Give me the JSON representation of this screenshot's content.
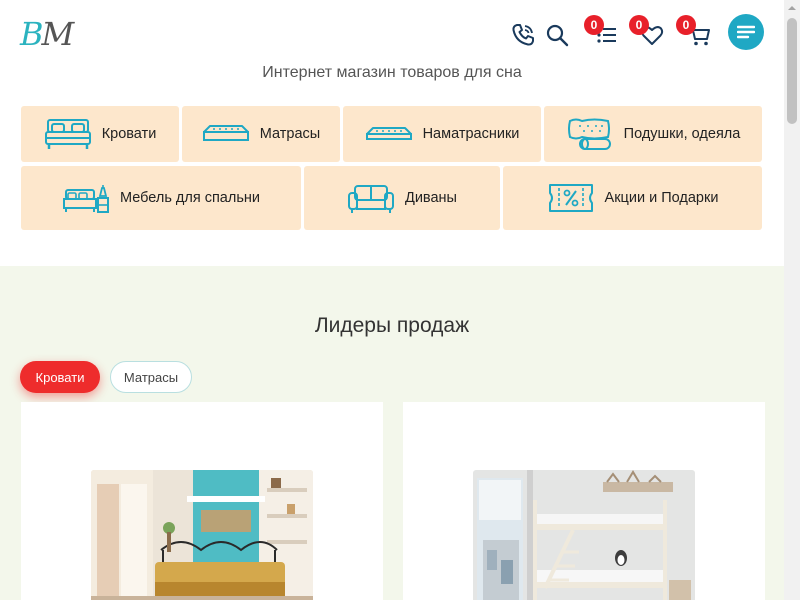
{
  "header": {
    "logo_letters": [
      "В",
      "М"
    ],
    "tagline": "Интернет магазин товаров для сна",
    "icons": {
      "phone": "phone-icon",
      "search": "search-icon",
      "compare": "compare-list-icon",
      "favorites": "heart-icon",
      "cart": "cart-icon",
      "menu": "menu-icon"
    },
    "compare_count": "0",
    "favorites_count": "0",
    "cart_count": "0"
  },
  "categories": [
    {
      "label": "Кровати",
      "icon": "bed-icon"
    },
    {
      "label": "Матрасы",
      "icon": "mattress-icon"
    },
    {
      "label": "Наматрасники",
      "icon": "mattress-topper-icon"
    },
    {
      "label": "Подушки, одеяла",
      "icon": "pillow-blanket-icon"
    },
    {
      "label": "Мебель для спальни",
      "icon": "bedroom-furniture-icon"
    },
    {
      "label": "Диваны",
      "icon": "sofa-icon"
    },
    {
      "label": "Акции и Подарки",
      "icon": "discount-ticket-icon"
    }
  ],
  "leaders": {
    "title": "Лидеры продаж",
    "tabs": [
      {
        "label": "Кровати",
        "active": true
      },
      {
        "label": "Матрасы",
        "active": false
      }
    ]
  },
  "colors": {
    "accent_teal": "#1fa8c4",
    "badge_red": "#e8202a",
    "category_bg": "#fde7cc",
    "section_bg": "#f3f7eb",
    "active_tab": "#ee2c2c"
  }
}
